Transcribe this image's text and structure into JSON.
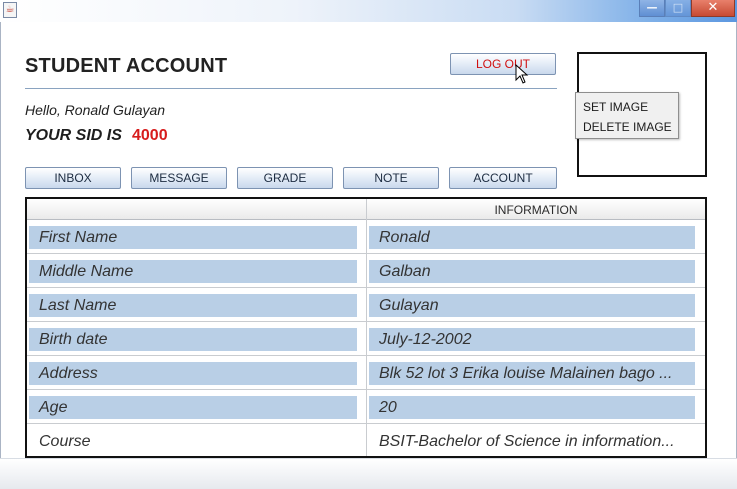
{
  "window": {
    "app_icon": "java-coffee-icon",
    "controls": {
      "minimize": "—",
      "maximize": "□",
      "close": "✕"
    }
  },
  "header": {
    "title": "STUDENT ACCOUNT",
    "logout_label": "LOG OUT",
    "greeting": "Hello, Ronald Gulayan",
    "sid_label": "YOUR SID IS",
    "sid_value": "4000"
  },
  "context_menu": {
    "items": [
      {
        "label": "SET IMAGE"
      },
      {
        "label": "DELETE IMAGE"
      }
    ]
  },
  "nav": {
    "inbox": "INBOX",
    "message": "MESSAGE",
    "grade": "GRADE",
    "note": "NOTE",
    "account": "ACCOUNT"
  },
  "table": {
    "columns": [
      "",
      "INFORMATION"
    ],
    "rows": [
      {
        "field": "First Name",
        "value": "Ronald"
      },
      {
        "field": "Middle Name",
        "value": "Galban"
      },
      {
        "field": "Last Name",
        "value": "Gulayan"
      },
      {
        "field": "Birth date",
        "value": "July-12-2002"
      },
      {
        "field": "Address",
        "value": "Blk 52 lot 3 Erika louise Malainen bago ..."
      },
      {
        "field": "Age",
        "value": "20"
      },
      {
        "field": "Course",
        "value": "BSIT-Bachelor of Science in information..."
      }
    ]
  },
  "colors": {
    "accent_red": "#d71c1c",
    "selection_blue": "#b9cfe6"
  }
}
